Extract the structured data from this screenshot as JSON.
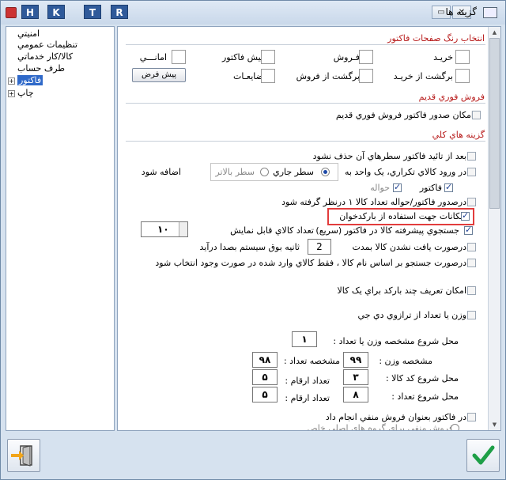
{
  "window": {
    "title": "گزينه ها",
    "hotkeys": [
      "H",
      "K",
      "T",
      "R"
    ],
    "buttons": {
      "minimize": "▭",
      "close": "✕"
    }
  },
  "tree": {
    "items": [
      {
        "label": "امنيتي"
      },
      {
        "label": "تنظيمات عمومي"
      },
      {
        "label": "کالا/کار خدماتي"
      },
      {
        "label": "طرف حساب"
      },
      {
        "label": "فاکتور",
        "expander": "+",
        "selected": true
      },
      {
        "label": "چاپ",
        "expander": "+"
      }
    ]
  },
  "colors": {
    "section_title": "#b81d1d",
    "selection": "#2f69c9",
    "highlight_border": "#e23c3c",
    "check_mark": "#1c3f94",
    "confirm_check": "#1e9f47"
  },
  "color_section": {
    "title": "انتخاب رنگ صفحات فاکتور",
    "items": [
      {
        "label": "خريـد"
      },
      {
        "label": "فـروش"
      },
      {
        "label": "پيش فاکتور"
      },
      {
        "label": "امانـــي"
      },
      {
        "label": "برگشت از خريـد"
      },
      {
        "label": "برگشت از فروش"
      },
      {
        "label": "ضايعـات"
      }
    ],
    "default_button": "پيش فرض"
  },
  "fast_sale": {
    "title": "فروش فوري قديم",
    "option": "امکان صدور فاکتور فروش فوري قديم"
  },
  "general": {
    "title": "گزينه هاي کلي",
    "opt_no_delete": "بعد از تائيد فاکتور سطرهاي آن حذف نشود",
    "opt_duplicate": "در ورود کالاي تکراري، يک واحد به",
    "add_suffix": "اضافه شود",
    "radio_current": "سطر جاري",
    "radio_above": "سطر بالاتر",
    "sub_invoice": "فاکتور",
    "sub_transfer": "حواله",
    "opt_issue_qty": "درصدور فاکتور/حواله تعداد کالا ۱ درنظر گرفته شود",
    "opt_barcode": "امکانات جهت استفاده از بارکدخوان",
    "opt_adv_search": "جستجوي پيشرفته کالا در فاکتور  (سريع)",
    "visible_count_label": "تعداد کالاي قابل نمايش",
    "visible_count_value": "۱۰",
    "opt_not_found_pre": "درصورت يافت نشدن کالا بمدت",
    "not_found_value": "2",
    "opt_not_found_post": "ثانيه بوق سيستم بصدا درآيد",
    "opt_search_name": "درصورت جستجو بر اساس نام کالا ، فقط کالاي وارد شده در صورت وجود انتخاب شود",
    "opt_multi_barcode": "امکان تعريف چند بارکد براي يک کالا",
    "opt_scale": "وزن يا تعداد از ترازوي دي جي",
    "scale_start_label": "محل شروع مشخصه وزن يا تعداد :",
    "scale_start_value": "۱",
    "weight_code_label": "مشخصه وزن :",
    "weight_code_value": "۹۹",
    "count_code_label": "مشخصه تعداد :",
    "count_code_value": "۹۸",
    "item_code_start_label": "محل شروع کد کالا :",
    "item_code_start_value": "۳",
    "item_digits_label": "تعداد  ارقام :",
    "item_digits_value": "۵",
    "count_start_label": "محل شروع تعداد :",
    "count_start_value": "۸",
    "count_digits_label": "تعداد  ارقام :",
    "count_digits_value": "۵",
    "opt_negative": "در فاکتور بعنوان فروش منفي انجام داد",
    "opt_negative_sub": "فروش منفي براي گروه هاي اصلي خاص"
  },
  "footer": {
    "exit_icon": "exit-door-icon",
    "confirm_icon": "check-icon"
  }
}
